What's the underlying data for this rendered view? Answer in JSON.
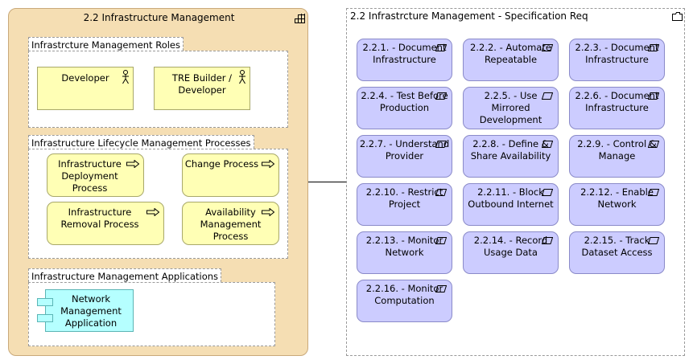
{
  "management": {
    "title": "2.2 Infrastructure Management",
    "roles": {
      "title": "Infrastrcture Management Roles",
      "items": [
        {
          "label": "Developer"
        },
        {
          "label": "TRE Builder / Developer"
        }
      ]
    },
    "processes": {
      "title": "Infrastructure Lifecycle Management Processes",
      "items": [
        {
          "label": "Infrastructure Deployment Process"
        },
        {
          "label": "Change Process"
        },
        {
          "label": "Infrastructure Removal Process"
        },
        {
          "label": "Availability Management Process"
        }
      ]
    },
    "applications": {
      "title": "Infrastructure Management Applications",
      "items": [
        {
          "label": "Network Management Application"
        }
      ]
    }
  },
  "specification": {
    "title": "2.2 Infrastrcture Management - Specification Req",
    "requirements": [
      {
        "label": "2.2.1. - Document Infrastructure"
      },
      {
        "label": "2.2.2. - Automate Repeatable"
      },
      {
        "label": "2.2.3. - Document Infrastructure"
      },
      {
        "label": "2.2.4. - Test Before Production"
      },
      {
        "label": "2.2.5. - Use Mirrored Development"
      },
      {
        "label": "2.2.6. - Document Infrastructure"
      },
      {
        "label": "2.2.7. - Understand Provider"
      },
      {
        "label": "2.2.8. - Define & Share Availability"
      },
      {
        "label": "2.2.9. - Control & Manage"
      },
      {
        "label": "2.2.10. - Restrict Project"
      },
      {
        "label": "2.2.11. - Block Outbound Internet"
      },
      {
        "label": "2.2.12. - Enable Network"
      },
      {
        "label": "2.2.13. - Monitor Network"
      },
      {
        "label": "2.2.14. - Record Usage Data"
      },
      {
        "label": "2.2.15. - Track Dataset Access"
      },
      {
        "label": "2.2.16. - Monitor Computation"
      }
    ]
  },
  "colors": {
    "grouping": "#f5deb3",
    "business_actor": "#ffffb5",
    "application": "#b5ffff",
    "requirement": "#ccccff"
  }
}
